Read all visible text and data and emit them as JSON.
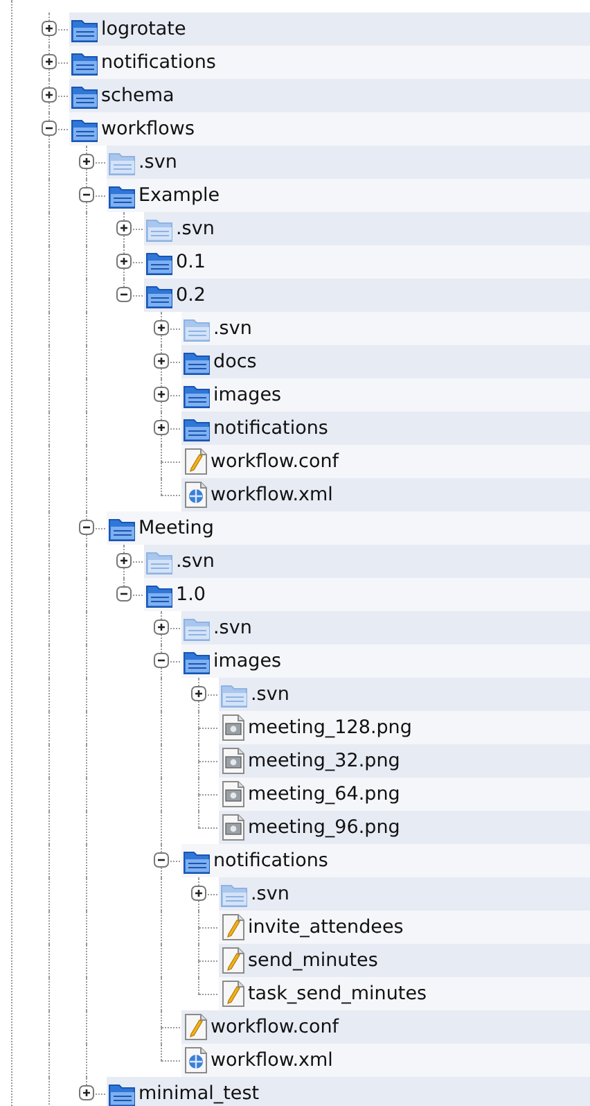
{
  "tree": {
    "items": [
      {
        "label": "logrotate",
        "kind": "folder",
        "expanded": false
      },
      {
        "label": "notifications",
        "kind": "folder",
        "expanded": false
      },
      {
        "label": "schema",
        "kind": "folder",
        "expanded": false
      },
      {
        "label": "workflows",
        "kind": "folder",
        "expanded": true,
        "children": [
          {
            "label": ".svn",
            "kind": "svn-folder",
            "expanded": false
          },
          {
            "label": "Example",
            "kind": "folder",
            "expanded": true,
            "children": [
              {
                "label": ".svn",
                "kind": "svn-folder",
                "expanded": false
              },
              {
                "label": "0.1",
                "kind": "folder",
                "expanded": false
              },
              {
                "label": "0.2",
                "kind": "folder",
                "expanded": true,
                "children": [
                  {
                    "label": ".svn",
                    "kind": "svn-folder",
                    "expanded": false
                  },
                  {
                    "label": "docs",
                    "kind": "folder",
                    "expanded": false
                  },
                  {
                    "label": "images",
                    "kind": "folder",
                    "expanded": false
                  },
                  {
                    "label": "notifications",
                    "kind": "folder",
                    "expanded": false
                  },
                  {
                    "label": "workflow.conf",
                    "kind": "text-file"
                  },
                  {
                    "label": "workflow.xml",
                    "kind": "xml-file"
                  }
                ]
              }
            ]
          },
          {
            "label": "Meeting",
            "kind": "folder",
            "expanded": true,
            "children": [
              {
                "label": ".svn",
                "kind": "svn-folder",
                "expanded": false
              },
              {
                "label": "1.0",
                "kind": "folder",
                "expanded": true,
                "children": [
                  {
                    "label": ".svn",
                    "kind": "svn-folder",
                    "expanded": false
                  },
                  {
                    "label": "images",
                    "kind": "folder",
                    "expanded": true,
                    "children": [
                      {
                        "label": ".svn",
                        "kind": "svn-folder",
                        "expanded": false
                      },
                      {
                        "label": "meeting_128.png",
                        "kind": "image-file"
                      },
                      {
                        "label": "meeting_32.png",
                        "kind": "image-file"
                      },
                      {
                        "label": "meeting_64.png",
                        "kind": "image-file"
                      },
                      {
                        "label": "meeting_96.png",
                        "kind": "image-file"
                      }
                    ]
                  },
                  {
                    "label": "notifications",
                    "kind": "folder",
                    "expanded": true,
                    "children": [
                      {
                        "label": ".svn",
                        "kind": "svn-folder",
                        "expanded": false
                      },
                      {
                        "label": "invite_attendees",
                        "kind": "text-file"
                      },
                      {
                        "label": "send_minutes",
                        "kind": "text-file"
                      },
                      {
                        "label": "task_send_minutes",
                        "kind": "text-file"
                      }
                    ]
                  },
                  {
                    "label": "workflow.conf",
                    "kind": "text-file"
                  },
                  {
                    "label": "workflow.xml",
                    "kind": "xml-file"
                  }
                ]
              }
            ]
          },
          {
            "label": "minimal_test",
            "kind": "folder",
            "expanded": false
          }
        ]
      }
    ]
  }
}
